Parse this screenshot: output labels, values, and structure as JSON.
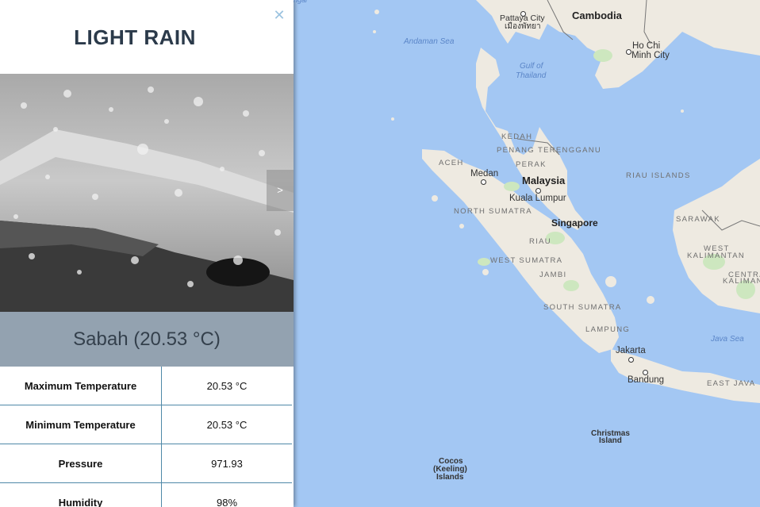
{
  "panel": {
    "close_icon": "close-icon",
    "title": "LIGHT RAIN",
    "next_icon": "chevron-right-icon",
    "next_symbol": ">",
    "location": "Sabah (20.53 °C)",
    "rows": [
      {
        "label": "Maximum Temperature",
        "value": "20.53 °C"
      },
      {
        "label": "Minimum Temperature",
        "value": "20.53 °C"
      },
      {
        "label": "Pressure",
        "value": "971.93"
      },
      {
        "label": "Humidity",
        "value": "98%"
      }
    ]
  },
  "map": {
    "seas": [
      "Andaman Sea",
      "Gulf of",
      "Thailand",
      "Java Sea"
    ],
    "countries": [
      "Cambodia",
      "Malaysia",
      "Singapore"
    ],
    "regions": [
      "KEDAH",
      "PENANG",
      "TERENGGANU",
      "PERAK",
      "ACEH",
      "NORTH SUMATRA",
      "RIAU",
      "WEST SUMATRA",
      "JAMBI",
      "SOUTH SUMATRA",
      "LAMPUNG",
      "RIAU ISLANDS",
      "SARAWAK",
      "WEST",
      "KALIMANTAN",
      "CENTRA",
      "KALIMAN",
      "EAST JAVA"
    ],
    "cities": [
      "Pattaya City",
      "เมืองพัทยา",
      "Ho Chi",
      "Minh City",
      "Medan",
      "Kuala Lumpur",
      "Jakarta",
      "Bandung"
    ],
    "islands": [
      "Christmas",
      "Island",
      "Cocos",
      "(Keeling)",
      "Islands"
    ],
    "partial_label": "ngai"
  }
}
